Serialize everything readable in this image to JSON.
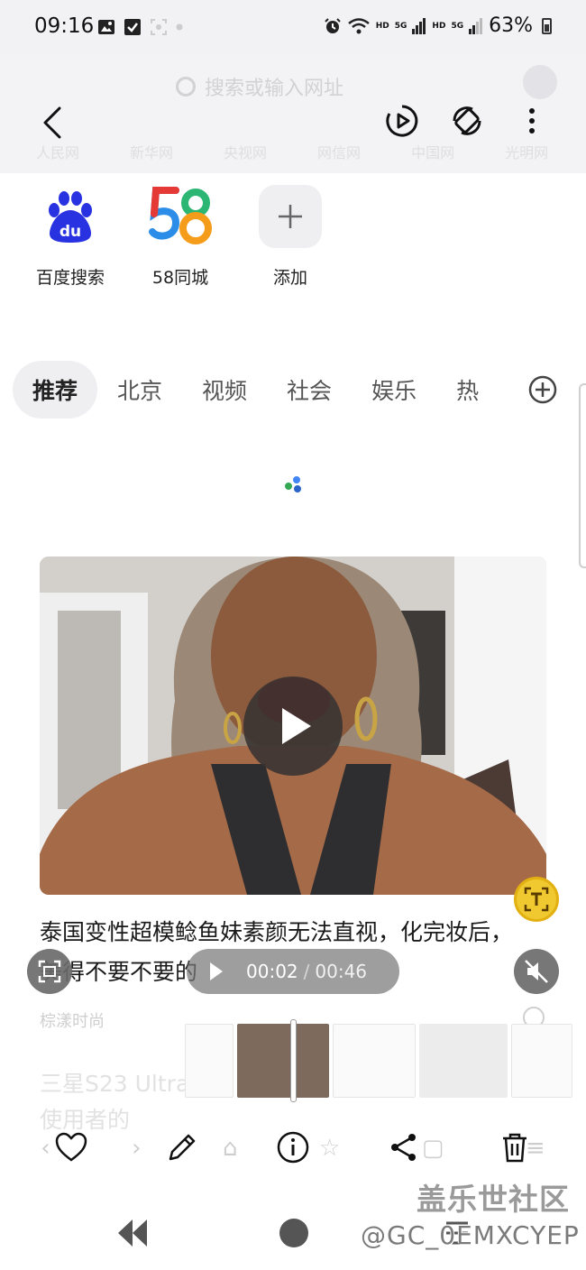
{
  "status_bar": {
    "time": "09:16",
    "net1": "HD",
    "sig1": "5G",
    "net2": "HD",
    "sig2": "5G",
    "battery": "63%"
  },
  "browser_ghost": {
    "search_placeholder": "搜索或输入网址",
    "links": [
      "人民网",
      "新华网",
      "央视网",
      "网信网",
      "中国网",
      "光明网"
    ]
  },
  "quick_links": [
    {
      "label": "百度搜索",
      "icon": "baidu-icon"
    },
    {
      "label": "58同城",
      "icon": "58-icon"
    },
    {
      "label": "添加",
      "icon": "plus-icon"
    }
  ],
  "tabs": [
    "推荐",
    "北京",
    "视频",
    "社会",
    "娱乐",
    "热"
  ],
  "article": {
    "headline": "泰国变性超模鲶鱼妹素颜无法直视，化完妆后，美得不要不要的",
    "source": "棕漾时尚",
    "next_headline_line1": "三星S23 Ultra",
    "next_headline_line2": "使用者的"
  },
  "player": {
    "current_time": "00:02",
    "separator": "/",
    "duration": "00:46"
  },
  "watermark": {
    "title": "盖乐世社区",
    "user": "@GC_0EMXCYEP"
  },
  "colors": {
    "baidu_blue": "#2932e1",
    "text_fab": "#f0c830"
  }
}
